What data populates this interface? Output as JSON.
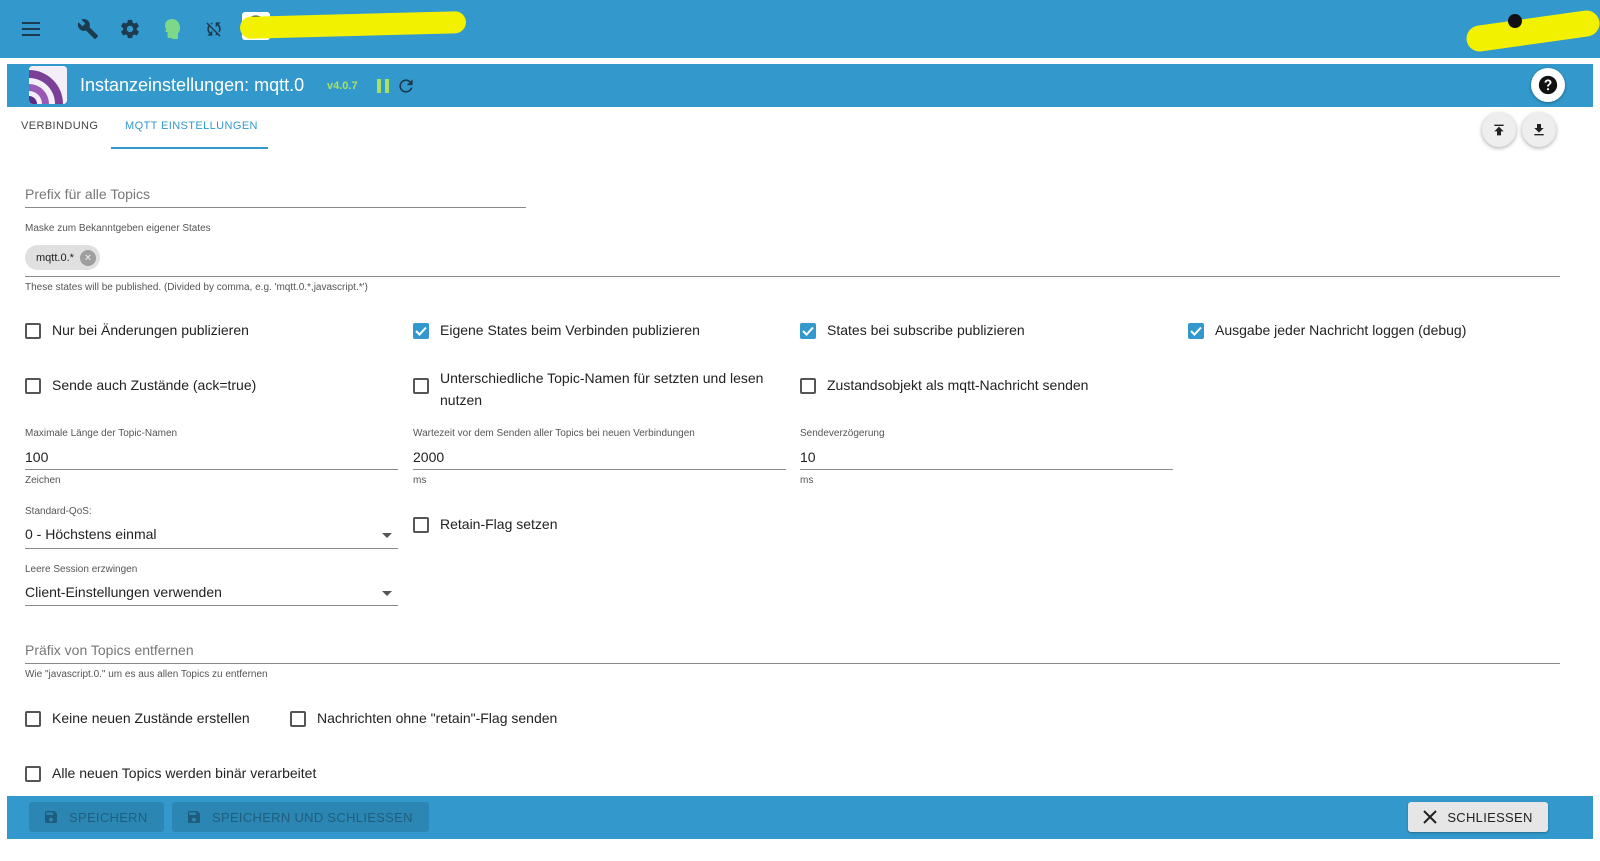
{
  "colors": {
    "primary": "#3399cc",
    "version_green": "#a8e063",
    "redaction": "#f2f200"
  },
  "appbar": {
    "icons": [
      "menu-icon",
      "wrench-icon",
      "settings-icon",
      "expert-head-icon",
      "sync-icon",
      "user-logo-icon"
    ]
  },
  "instance": {
    "title": "Instanzeinstellungen: mqtt.0",
    "version": "v4.0.7",
    "icons": [
      "pause-icon",
      "reload-icon",
      "help-icon"
    ]
  },
  "tabs": [
    {
      "label": "VERBINDUNG",
      "active": false
    },
    {
      "label": "MQTT EINSTELLUNGEN",
      "active": true
    }
  ],
  "form": {
    "prefix": {
      "placeholder": "Prefix für alle Topics",
      "value": ""
    },
    "mask": {
      "label": "Maske zum Bekanntgeben eigener States",
      "chips": [
        "mqtt.0.*"
      ],
      "helper": "These states will be published. (Divided by comma, e.g. 'mqtt.0.*,javascript.*')"
    },
    "checkboxes_row1": [
      {
        "label": "Nur bei Änderungen publizieren",
        "checked": false
      },
      {
        "label": "Eigene States beim Verbinden publizieren",
        "checked": true
      },
      {
        "label": "States bei subscribe publizieren",
        "checked": true
      },
      {
        "label": "Ausgabe jeder Nachricht loggen (debug)",
        "checked": true
      }
    ],
    "checkboxes_row2": [
      {
        "label": "Sende auch Zustände (ack=true)",
        "checked": false
      },
      {
        "label": "Unterschiedliche Topic-Namen für setzten und lesen nutzen",
        "checked": false
      },
      {
        "label": "Zustandsobjekt als mqtt-Nachricht senden",
        "checked": false
      }
    ],
    "max_length": {
      "label": "Maximale Länge der Topic-Namen",
      "value": "100",
      "helper": "Zeichen"
    },
    "wait_time": {
      "label": "Wartezeit vor dem Senden aller Topics bei neuen Verbindungen",
      "value": "2000",
      "helper": "ms"
    },
    "send_delay": {
      "label": "Sendeverzögerung",
      "value": "10",
      "helper": "ms"
    },
    "qos": {
      "label": "Standard-QoS:",
      "value": "0 - Höchstens einmal"
    },
    "retain": {
      "label": "Retain-Flag setzen",
      "checked": false
    },
    "clean_session": {
      "label": "Leere Session erzwingen",
      "value": "Client-Einstellungen verwenden"
    },
    "remove_prefix": {
      "placeholder": "Präfix von Topics entfernen",
      "value": "",
      "helper": "Wie \"javascript.0.\" um es aus allen Topics zu entfernen"
    },
    "checkboxes_row3": [
      {
        "label": "Keine neuen Zustände erstellen",
        "checked": false
      },
      {
        "label": "Nachrichten ohne \"retain\"-Flag senden",
        "checked": false
      }
    ],
    "binary": {
      "label": "Alle neuen Topics werden binär verarbeitet",
      "checked": false
    }
  },
  "footer": {
    "save_label": "SPEICHERN",
    "save_close_label": "SPEICHERN UND SCHLIESSEN",
    "close_label": "SCHLIESSEN"
  }
}
